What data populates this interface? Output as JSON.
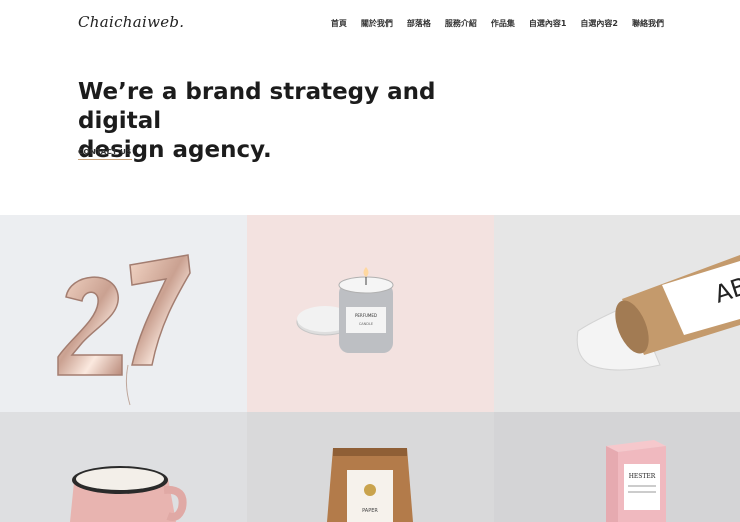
{
  "header": {
    "logo": "Chaichaiweb.",
    "nav": [
      "首頁",
      "關於我們",
      "部落格",
      "服務介紹",
      "作品集",
      "自選內容1",
      "自選內容2",
      "聯絡我們"
    ]
  },
  "hero": {
    "title_line1": "We’re a brand strategy and digital",
    "title_line2": "design agency.",
    "cta": "CONTACT US"
  },
  "portfolio": {
    "items": [
      {
        "name": "balloon-27",
        "label": "27"
      },
      {
        "name": "candle",
        "label": "PERFUMED CANDLE"
      },
      {
        "name": "poster-tube",
        "label": "AB"
      },
      {
        "name": "mug"
      },
      {
        "name": "coffee-bag",
        "label": "PAPER"
      },
      {
        "name": "box",
        "label": "HESTER"
      }
    ]
  },
  "colors": {
    "accent_underline": "#c9a27a",
    "text": "#1c1c1c"
  }
}
